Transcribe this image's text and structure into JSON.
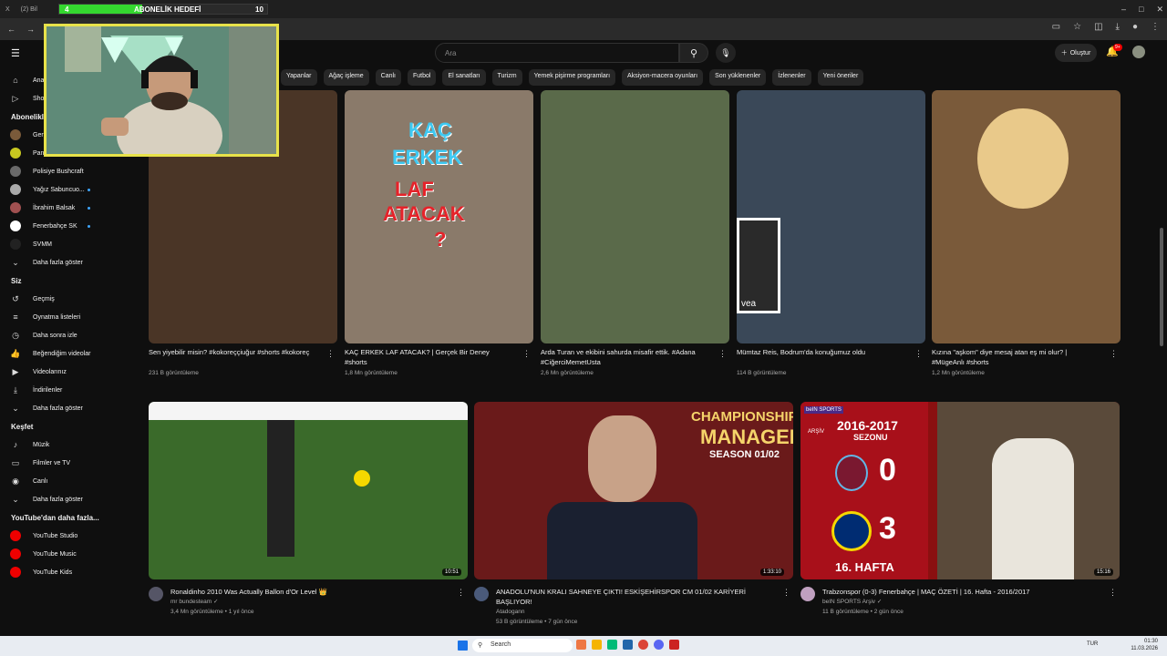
{
  "browser": {
    "tabs": [
      "X",
      "(2) Bil"
    ],
    "goal": {
      "start": "4",
      "label": "ABONELİK HEDEFİ",
      "end": "10",
      "progress": 0.4
    },
    "win_controls": [
      "–",
      "□",
      "✕"
    ]
  },
  "youtube": {
    "search_placeholder": "Ara",
    "create_label": "Oluştur",
    "notif_count": "9+",
    "chips": [
      "Yapanlar",
      "Ağaç işleme",
      "Canlı",
      "Futbol",
      "El sanatları",
      "Turizm",
      "Yemek pişirme programları",
      "Aksiyon-macera oyunları",
      "Son yüklenenler",
      "İzlenenler",
      "Yeni öneriler"
    ]
  },
  "sidebar": {
    "top": [
      {
        "label": "Ana",
        "icon": "home-icon"
      },
      {
        "label": "Sho",
        "icon": "shorts-icon"
      }
    ],
    "subs_head": "Abonelikler",
    "subs": [
      {
        "label": "Ger",
        "color": "#7a5a3a",
        "dot": false
      },
      {
        "label": "Pangvoss",
        "color": "#c8c820",
        "dot": false
      },
      {
        "label": "Polisiye Bushcraft",
        "color": "#6a6a6a",
        "dot": false
      },
      {
        "label": "Yağız Sabuncuo...",
        "color": "#aaa",
        "dot": true
      },
      {
        "label": "İbrahim Balsak",
        "color": "#a05050",
        "dot": true
      },
      {
        "label": "Fenerbahçe SK",
        "color": "#ffffff",
        "dot": true
      },
      {
        "label": "SVMM",
        "color": "#222",
        "dot": false
      },
      {
        "label": "Daha fazla göster",
        "color": "",
        "dot": false
      }
    ],
    "you_head": "Siz",
    "you": [
      {
        "label": "Geçmiş",
        "icon": "history-icon"
      },
      {
        "label": "Oynatma listeleri",
        "icon": "playlist-icon"
      },
      {
        "label": "Daha sonra izle",
        "icon": "clock-icon"
      },
      {
        "label": "Beğendiğim videolar",
        "icon": "like-icon"
      },
      {
        "label": "Videolarınız",
        "icon": "video-icon"
      },
      {
        "label": "İndirilenler",
        "icon": "download-icon"
      },
      {
        "label": "Daha fazla göster",
        "icon": "chevron-down-icon"
      }
    ],
    "explore_head": "Keşfet",
    "explore": [
      {
        "label": "Müzik",
        "icon": "music-icon"
      },
      {
        "label": "Filmler ve TV",
        "icon": "film-icon"
      },
      {
        "label": "Canlı",
        "icon": "live-icon"
      },
      {
        "label": "Daha fazla göster",
        "icon": "chevron-down-icon"
      }
    ],
    "more_head": "YouTube'dan daha fazla...",
    "more": [
      {
        "label": "YouTube Studio"
      },
      {
        "label": "YouTube Music"
      },
      {
        "label": "YouTube Kids"
      }
    ]
  },
  "shorts": [
    {
      "title": "Sen yiyebilir misin?  #kokoreççiuğur #shorts #kokoreç",
      "views": "231 B görüntüleme",
      "bg": "#4a3526"
    },
    {
      "title": "KAÇ ERKEK LAF ATACAK? | Gerçek Bir Deney #shorts",
      "views": "1,8 Mn görüntüleme",
      "bg": "#8a7a6a"
    },
    {
      "title": "Arda Turan ve ekibini sahurda misafir ettik. #Adana #CiğerciMemetUsta",
      "views": "2,6 Mn görüntüleme",
      "bg": "#5a6a4a"
    },
    {
      "title": "Mümtaz Reis, Bodrum'da konuğumuz oldu",
      "views": "114 B görüntüleme",
      "bg": "#3a4858"
    },
    {
      "title": "Kızına \"aşkom\" diye mesaj atan eş mi olur? | #MügeAnlı #shorts",
      "views": "1,2 Mn görüntüleme",
      "bg": "#7a5a3a"
    }
  ],
  "short_thumb_text": {
    "kac": "KAÇ",
    "erkek": "ERKEK",
    "laf": "LAF",
    "atacak": "ATACAK",
    "q": "?",
    "vea": "vea"
  },
  "videos": [
    {
      "title": "Ronaldinho 2010 Was Actually Ballon d'Or Level 👑",
      "channel": "mr bundesteam ✓",
      "meta": "3,4 Mn görüntüleme • 1 yıl önce",
      "duration": "10:51",
      "avatar": "#556"
    },
    {
      "title": "ANADOLU'NUN KRALI SAHNEYE ÇIKTI! ESKİŞEHİRSPOR CM 01/02 KARİYERİ BAŞLIYOR!",
      "channel": "Atadogann",
      "meta": "53 B görüntüleme • 7 gün önce",
      "duration": "1:33:10",
      "avatar": "#4a5a7a"
    },
    {
      "title": "Trabzonspor (0-3) Fenerbahçe | MAÇ ÖZETİ | 16. Hafta - 2016/2017",
      "channel": "beIN SPORTS Arşiv ✓",
      "meta": "11 B görüntüleme • 2 gün önce",
      "duration": "15:16",
      "avatar": "#c0a0c0"
    }
  ],
  "v2_thumb": {
    "l1": "CHAMPIONSHIP",
    "l2": "MANAGER",
    "l3": "SEASON 01/02"
  },
  "v3_thumb": {
    "season": "2016-2017",
    "sezonu": "SEZONU",
    "s1": "0",
    "s2": "3",
    "week": "16. HAFTA",
    "brand": "beIN SPORTS",
    "arsiv": "ARŞİV"
  },
  "taskbar": {
    "search": "Search",
    "lang": "TUR",
    "time": "01:30",
    "date": "11.03.2026"
  }
}
